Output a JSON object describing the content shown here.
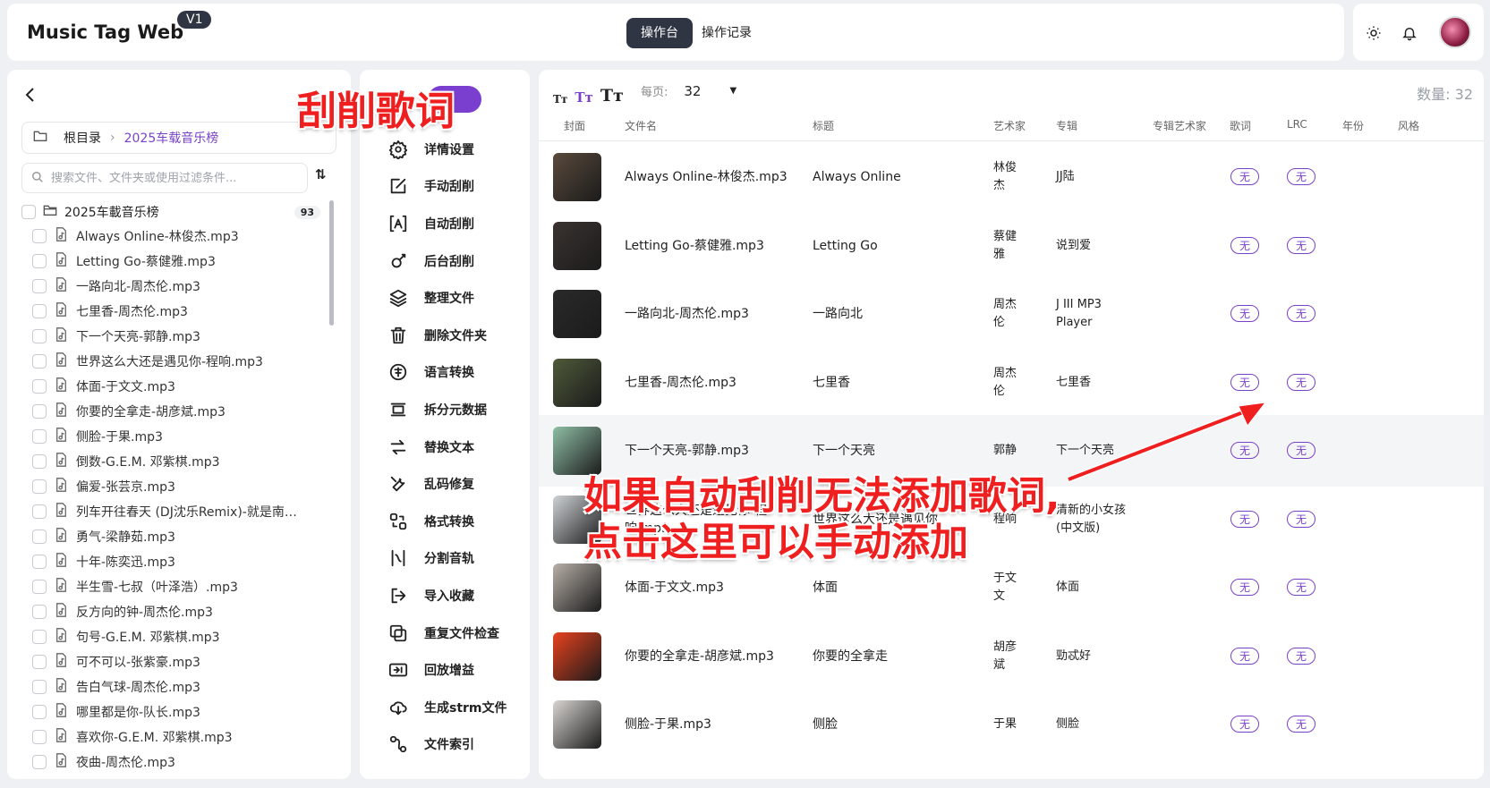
{
  "header": {
    "brand": "Music Tag Web",
    "version": "V1",
    "tabs": [
      "操作台",
      "操作记录"
    ]
  },
  "left": {
    "breadcrumb_root": "根目录",
    "breadcrumb_current": "2025车载音乐榜",
    "search_placeholder": "搜索文件、文件夹或使用过滤条件...",
    "folder_name": "2025车載音乐榜",
    "folder_count": "93",
    "files": [
      "Always Online-林俊杰.mp3",
      "Letting Go-蔡健雅.mp3",
      "一路向北-周杰伦.mp3",
      "七里香-周杰伦.mp3",
      "下一个天亮-郭静.mp3",
      "世界这么大还是遇见你-程响.mp3",
      "体面-于文文.mp3",
      "你要的全拿走-胡彦斌.mp3",
      "侧脸-于果.mp3",
      "倒数-G.E.M. 邓紫棋.mp3",
      "偏爱-张芸京.mp3",
      "列车开往春天 (DJ沈乐Remix)-就是南方...",
      "勇气-梁静茹.mp3",
      "十年-陈奕迅.mp3",
      "半生雪-七叔（叶泽浩）.mp3",
      "反方向的钟-周杰伦.mp3",
      "句号-G.E.M. 邓紫棋.mp3",
      "可不可以-张紫豪.mp3",
      "告白气球-周杰伦.mp3",
      "哪里都是你-队长.mp3",
      "喜欢你-G.E.M. 邓紫棋.mp3",
      "夜曲-周杰伦.mp3"
    ]
  },
  "actions": [
    {
      "label": "详情设置",
      "icon": "gear-icon"
    },
    {
      "label": "手动刮削",
      "icon": "edit-icon"
    },
    {
      "label": "自动刮削",
      "icon": "auto-icon"
    },
    {
      "label": "后台刮削",
      "icon": "satellite-icon"
    },
    {
      "label": "整理文件",
      "icon": "layers-icon"
    },
    {
      "label": "删除文件夹",
      "icon": "trash-icon"
    },
    {
      "label": "语言转换",
      "icon": "language-icon"
    },
    {
      "label": "拆分元数据",
      "icon": "split-icon"
    },
    {
      "label": "替换文本",
      "icon": "replace-icon"
    },
    {
      "label": "乱码修复",
      "icon": "wrench-icon"
    },
    {
      "label": "格式转换",
      "icon": "convert-icon"
    },
    {
      "label": "分割音轨",
      "icon": "scissor-icon"
    },
    {
      "label": "导入收藏",
      "icon": "import-icon"
    },
    {
      "label": "重复文件检查",
      "icon": "duplicate-icon"
    },
    {
      "label": "回放增益",
      "icon": "gain-icon"
    },
    {
      "label": "生成strm文件",
      "icon": "cloud-download-icon"
    },
    {
      "label": "文件索引",
      "icon": "index-icon"
    }
  ],
  "table": {
    "per_page_label": "每页:",
    "per_page_value": "32",
    "count_label": "数量: 32",
    "columns": [
      "封面",
      "文件名",
      "标题",
      "艺术家",
      "专辑",
      "专辑艺术家",
      "歌词",
      "LRC",
      "年份",
      "风格"
    ],
    "rows": [
      {
        "file": "Always Online-林俊杰.mp3",
        "title": "Always Online",
        "artist": "林俊杰",
        "album": "JJ陆",
        "lyrics": "无",
        "lrc": "无",
        "cover": "#5a4a3c"
      },
      {
        "file": "Letting Go-蔡健雅.mp3",
        "title": "Letting Go",
        "artist": "蔡健雅",
        "album": "说到爱",
        "lyrics": "无",
        "lrc": "无",
        "cover": "#3a3330"
      },
      {
        "file": "一路向北-周杰伦.mp3",
        "title": "一路向北",
        "artist": "周杰伦",
        "album": "J III MP3 Player",
        "lyrics": "无",
        "lrc": "无",
        "cover": "#2a2a2a"
      },
      {
        "file": "七里香-周杰伦.mp3",
        "title": "七里香",
        "artist": "周杰伦",
        "album": "七里香",
        "lyrics": "无",
        "lrc": "无",
        "cover": "#4e5a3a"
      },
      {
        "file": "下一个天亮-郭静.mp3",
        "title": "下一个天亮",
        "artist": "郭静",
        "album": "下一个天亮",
        "lyrics": "无",
        "lrc": "无",
        "cover": "#8fbfa6"
      },
      {
        "file": "世界这么大还是遇见你-程响.mp3",
        "title": "世界这么大还是遇见你",
        "artist": "程响",
        "album": "清新的小女孩 (中文版)",
        "lyrics": "无",
        "lrc": "无",
        "cover": "#cfd3d6"
      },
      {
        "file": "体面-于文文.mp3",
        "title": "体面",
        "artist": "于文文",
        "album": "体面",
        "lyrics": "无",
        "lrc": "无",
        "cover": "#b8b0a8"
      },
      {
        "file": "你要的全拿走-胡彦斌.mp3",
        "title": "你要的全拿走",
        "artist": "胡彦斌",
        "album": "勁忒好",
        "lyrics": "无",
        "lrc": "无",
        "cover": "#e8421e"
      },
      {
        "file": "侧脸-于果.mp3",
        "title": "侧脸",
        "artist": "于果",
        "album": "侧脸",
        "lyrics": "无",
        "lrc": "无",
        "cover": "#d9d6d2"
      }
    ]
  },
  "annotations": {
    "top": "刮削歌词",
    "bottom_line1": "如果自动刮削无法添加歌词,",
    "bottom_line2": "点击这里可以手动添加",
    "arrow_color": "#f01f1f"
  }
}
